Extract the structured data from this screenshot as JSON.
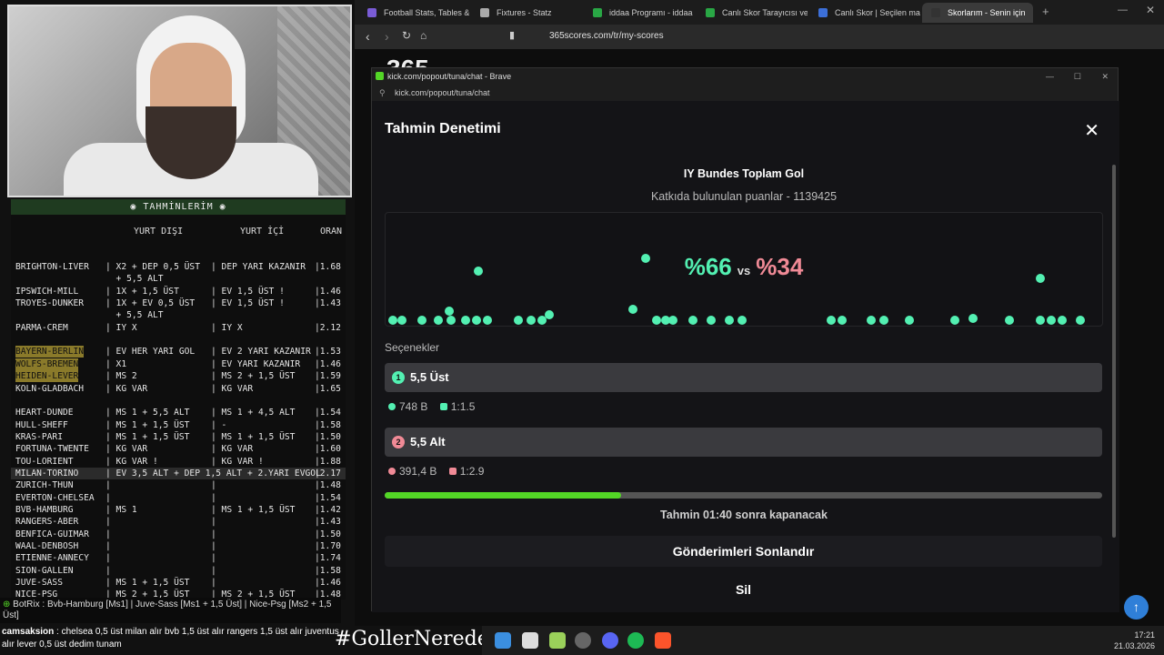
{
  "browser": {
    "tabs": [
      {
        "label": "Football Stats, Tables & D",
        "color": "#7a5cd6"
      },
      {
        "label": "Fixtures - Statz",
        "color": "#aaaaaa"
      },
      {
        "label": "iddaa Programı - iddaa Bi",
        "color": "#29a745"
      },
      {
        "label": "Canlı Skor Tarayıcısı ve Ca",
        "color": "#29a745"
      },
      {
        "label": "Canlı Skor | Seçilen maçla",
        "color": "#3c6fd8"
      },
      {
        "label": "Skorlarım - Senin için",
        "color": "#333333"
      }
    ],
    "url": "365scores.com/tr/my-scores",
    "bg_logo": "365"
  },
  "popup": {
    "title": "kick.com/popout/tuna/chat - Brave",
    "url": "kick.com/popout/tuna/chat",
    "modal_title": "Tahmin Denetimi",
    "question": "IY Bundes Toplam Gol",
    "points_text": "Katkıda bulunulan puanlar - 1139425",
    "percent_a": "%66",
    "vs": "vs",
    "percent_b": "%34",
    "options_label": "Seçenekler",
    "options": [
      {
        "num": "1",
        "label": "5,5 Üst",
        "points": "748 B",
        "ratio": "1:1.5",
        "color": "#53f0b2"
      },
      {
        "num": "2",
        "label": "5,5 Alt",
        "points": "391,4 B",
        "ratio": "1:2.9",
        "color": "#f08a96"
      }
    ],
    "progress_fraction": 0.33,
    "close_text": "Tahmin 01:40 sonra kapanacak",
    "end_button": "Gönderimleri Sonlandır",
    "delete_button": "Sil"
  },
  "predictions": {
    "title": "TAHMİNLERİM",
    "headers": {
      "abroad": "YURT DIŞI",
      "domestic": "YURT İÇİ",
      "odds": "ORAN"
    },
    "rows": [
      {
        "match": "BRIGHTON-LIVER",
        "abroad": "| X2 + DEP 0,5 ÜST",
        "domestic": "| DEP YARI KAZANIR",
        "odds": "|1.68"
      },
      {
        "match": "",
        "abroad": "  + 5,5 ALT",
        "domestic": "",
        "odds": ""
      },
      {
        "match": "IPSWICH-MILL",
        "abroad": "| 1X + 1,5 ÜST",
        "domestic": "| EV 1,5 ÜST !",
        "odds": "|1.46"
      },
      {
        "match": "TROYES-DUNKER",
        "abroad": "| 1X + EV 0,5 ÜST",
        "domestic": "| EV 1,5 ÜST !",
        "odds": "|1.43"
      },
      {
        "match": "",
        "abroad": "  + 5,5 ALT",
        "domestic": "",
        "odds": ""
      },
      {
        "match": "PARMA-CREM",
        "abroad": "| IY X",
        "domestic": "| IY X",
        "odds": "|2.12"
      },
      {
        "match": "",
        "abroad": "",
        "domestic": "",
        "odds": ""
      },
      {
        "match": "BAYERN-BERLIN",
        "abroad": "| EV HER YARI GOL",
        "domestic": "| EV 2 YARI KAZANIR",
        "odds": "|1.53"
      },
      {
        "match": "WOLFS-BREMEN",
        "abroad": "| X1",
        "domestic": "| EV YARI KAZANIR",
        "odds": "|1.46"
      },
      {
        "match": "HEIDEN-LEVER",
        "abroad": "| MS 2",
        "domestic": "| MS 2 + 1,5 ÜST",
        "odds": "|1.59"
      },
      {
        "match": "KOLN-GLADBACH",
        "abroad": "| KG VAR",
        "domestic": "| KG VAR",
        "odds": "|1.65"
      },
      {
        "match": "",
        "abroad": "",
        "domestic": "",
        "odds": ""
      },
      {
        "match": "HEART-DUNDE",
        "abroad": "| MS 1 + 5,5 ALT",
        "domestic": "| MS 1 + 4,5 ALT",
        "odds": "|1.54"
      },
      {
        "match": "HULL-SHEFF",
        "abroad": "| MS 1 + 1,5 ÜST",
        "domestic": "| -",
        "odds": "|1.58"
      },
      {
        "match": "KRAS-PARI",
        "abroad": "| MS 1 + 1,5 ÜST",
        "domestic": "| MS 1 + 1,5 ÜST",
        "odds": "|1.50"
      },
      {
        "match": "FORTUNA-TWENTE",
        "abroad": "| KG VAR",
        "domestic": "| KG VAR",
        "odds": "|1.60"
      },
      {
        "match": "TOU-LORIENT",
        "abroad": "| KG VAR !",
        "domestic": "| KG VAR !",
        "odds": "|1.88"
      },
      {
        "match": "MILAN-TORINO",
        "abroad": "| EV 3,5 ALT + DEP 1,5 ALT + 2.YARI EVGOL",
        "domestic": "",
        "odds": "|2.17"
      },
      {
        "match": "ZURICH-THUN",
        "abroad": "|",
        "domestic": "|",
        "odds": "|1.48"
      },
      {
        "match": "EVERTON-CHELSEA",
        "abroad": "|",
        "domestic": "|",
        "odds": "|1.54"
      },
      {
        "match": "BVB-HAMBURG",
        "abroad": "| MS 1",
        "domestic": "| MS 1 + 1,5 ÜST",
        "odds": "|1.42"
      },
      {
        "match": "RANGERS-ABER",
        "abroad": "|",
        "domestic": "|",
        "odds": "|1.43"
      },
      {
        "match": "BENFICA-GUIMAR",
        "abroad": "|",
        "domestic": "|",
        "odds": "|1.50"
      },
      {
        "match": "WAAL-DENBOSH",
        "abroad": "|",
        "domestic": "|",
        "odds": "|1.70"
      },
      {
        "match": "ETIENNE-ANNECY",
        "abroad": "|",
        "domestic": "|",
        "odds": "|1.74"
      },
      {
        "match": "SION-GALLEN",
        "abroad": "|",
        "domestic": "|",
        "odds": "|1.58"
      },
      {
        "match": "JUVE-SASS",
        "abroad": "| MS 1 + 1,5 ÜST",
        "domestic": "|",
        "odds": "|1.46"
      },
      {
        "match": "NICE-PSG",
        "abroad": "| MS 2 + 1,5 ÜST",
        "domestic": "| MS 2 + 1,5 ÜST",
        "odds": "|1.48"
      }
    ]
  },
  "chat": {
    "bot_line": "BotRix : Bvb-Hamburg [Ms1] | Juve-Sass [Ms1 + 1,5 Üst] | Nice-Psg [Ms2 + 1,5 Üst]",
    "user": "camsaksion",
    "message": " : chelsea 0,5 üst milan alır bvb 1,5 üst alır rangers 1,5 üst alır juventus alır lever 0,5 üst dedim tunam",
    "hashtag": "#GollerNerede"
  },
  "clock": {
    "time": "17:21",
    "date": "21.03.2026"
  }
}
